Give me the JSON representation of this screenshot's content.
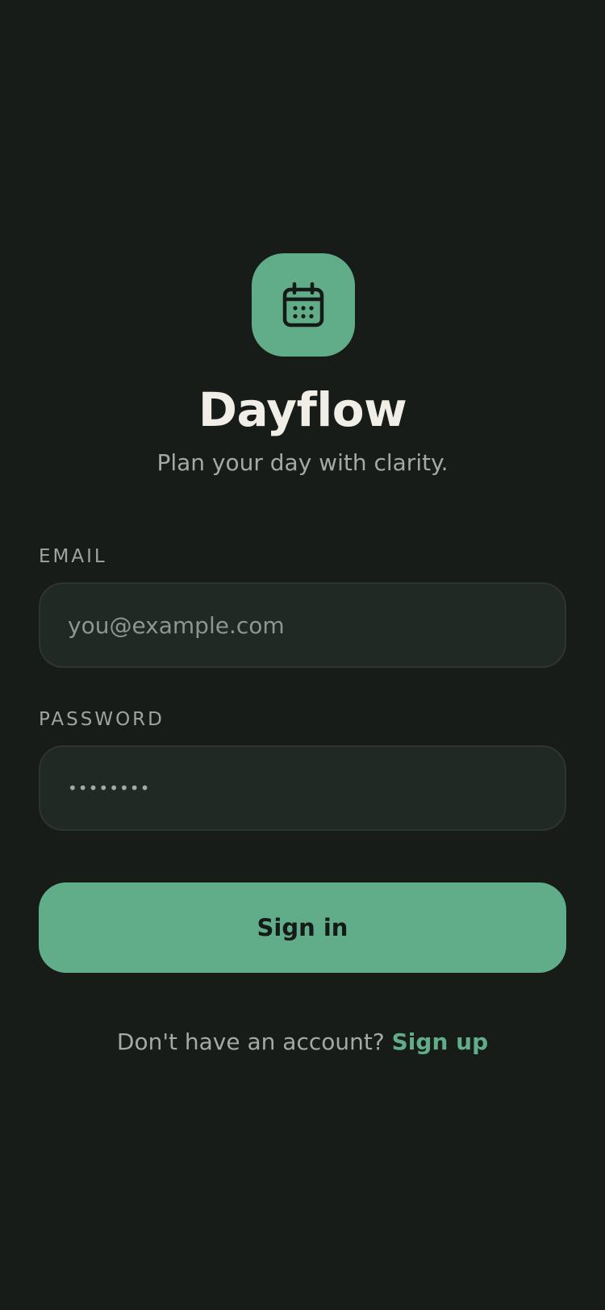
{
  "app": {
    "name": "Dayflow",
    "tagline": "Plan your day with clarity.",
    "logo_icon": "calendar-icon"
  },
  "form": {
    "email_label": "EMAIL",
    "email_placeholder": "you@example.com",
    "email_value": "",
    "password_label": "PASSWORD",
    "password_value_masked": "••••••••",
    "submit_label": "Sign in"
  },
  "footer": {
    "prompt": "Don't have an account?",
    "link_label": "Sign up"
  },
  "colors": {
    "background": "#171c19",
    "accent": "#62ad89",
    "input_background": "#212925",
    "title_text": "#f1eee8",
    "muted_text": "#a3aaa5"
  }
}
